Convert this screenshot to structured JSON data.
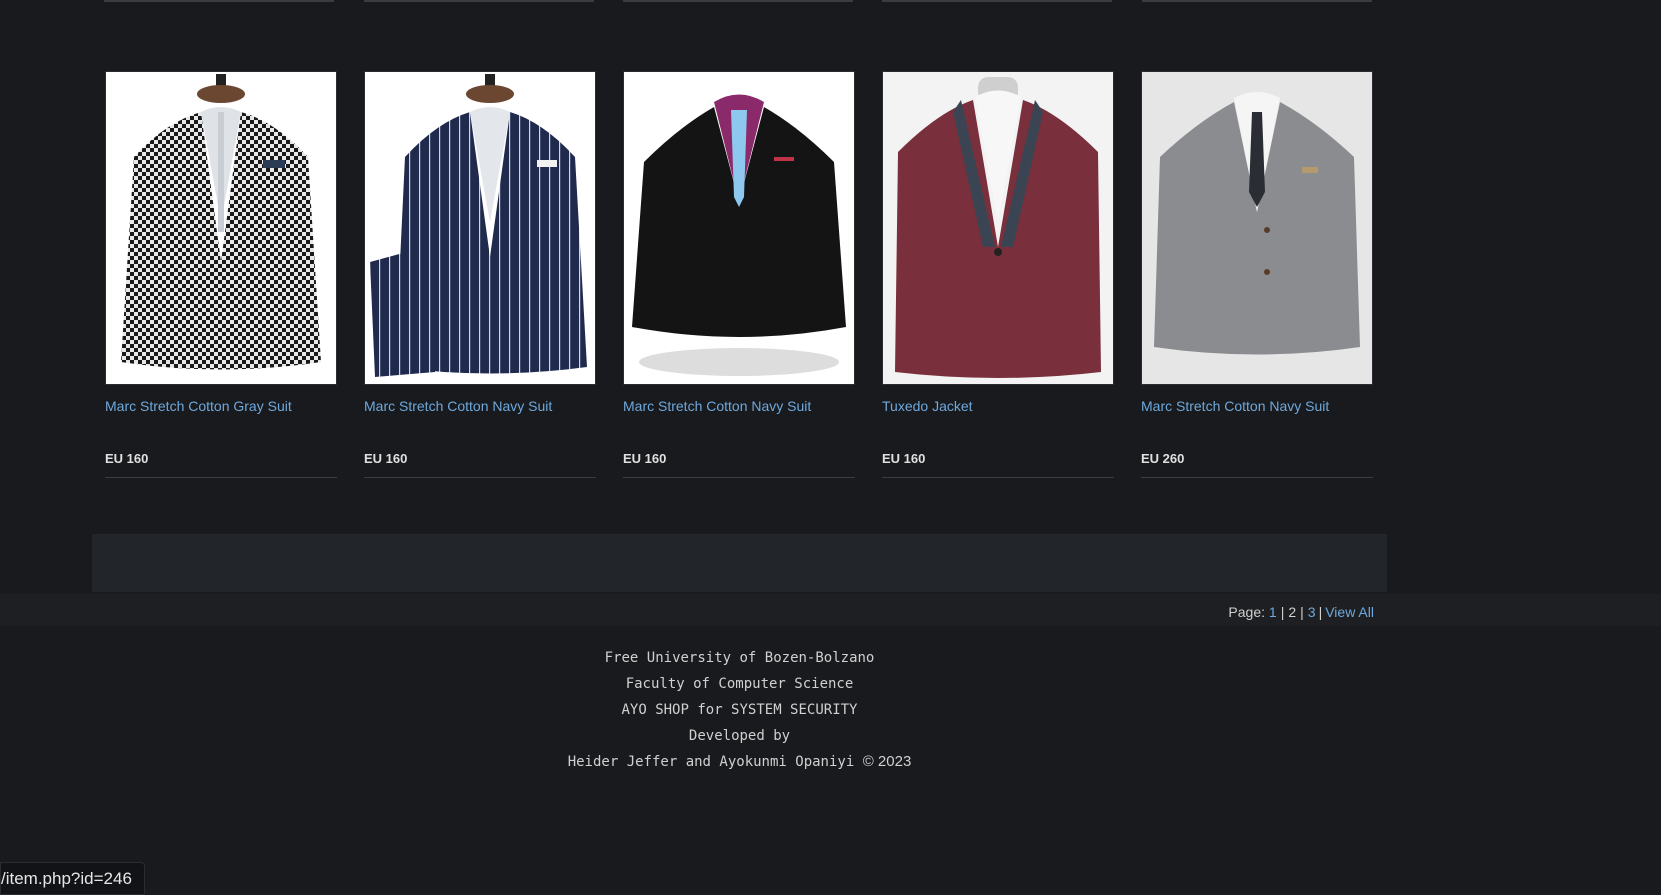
{
  "products": [
    {
      "name": "Marc Stretch Cotton Gray Suit",
      "price": "EU 160",
      "icon": "houndstooth-suit-icon",
      "jacket_color": "#d8d8d8",
      "bg": "#ffffff"
    },
    {
      "name": "Marc Stretch Cotton Navy Suit",
      "price": "EU 160",
      "icon": "navy-pinstripe-suit-icon",
      "jacket_color": "#1f2a4d",
      "bg": "#ffffff"
    },
    {
      "name": "Marc Stretch Cotton Navy Suit",
      "price": "EU 160",
      "icon": "black-velvet-jacket-icon",
      "jacket_color": "#141414",
      "bg": "#ffffff"
    },
    {
      "name": "Tuxedo Jacket",
      "price": "EU 160",
      "icon": "burgundy-tuxedo-jacket-icon",
      "jacket_color": "#7a2f3c",
      "bg": "#f3f3f3"
    },
    {
      "name": "Marc Stretch Cotton Navy Suit",
      "price": "EU 260",
      "icon": "gray-tweed-jacket-icon",
      "jacket_color": "#8a8c90",
      "bg": "#e6e6e6"
    }
  ],
  "pagination": {
    "label": "Page:",
    "pages": [
      "1",
      "2",
      "3"
    ],
    "view_all": "View All"
  },
  "footer": {
    "line1": "Free University of Bozen-Bolzano",
    "line2": "Faculty of Computer Science",
    "line3": "AYO SHOP for SYSTEM SECURITY",
    "line4": "Developed by",
    "line5": "Heider Jeffer and Ayokunmi Opaniyi",
    "copyright": "© 2023"
  },
  "status_bar": {
    "url": "/item.php?id=246"
  }
}
